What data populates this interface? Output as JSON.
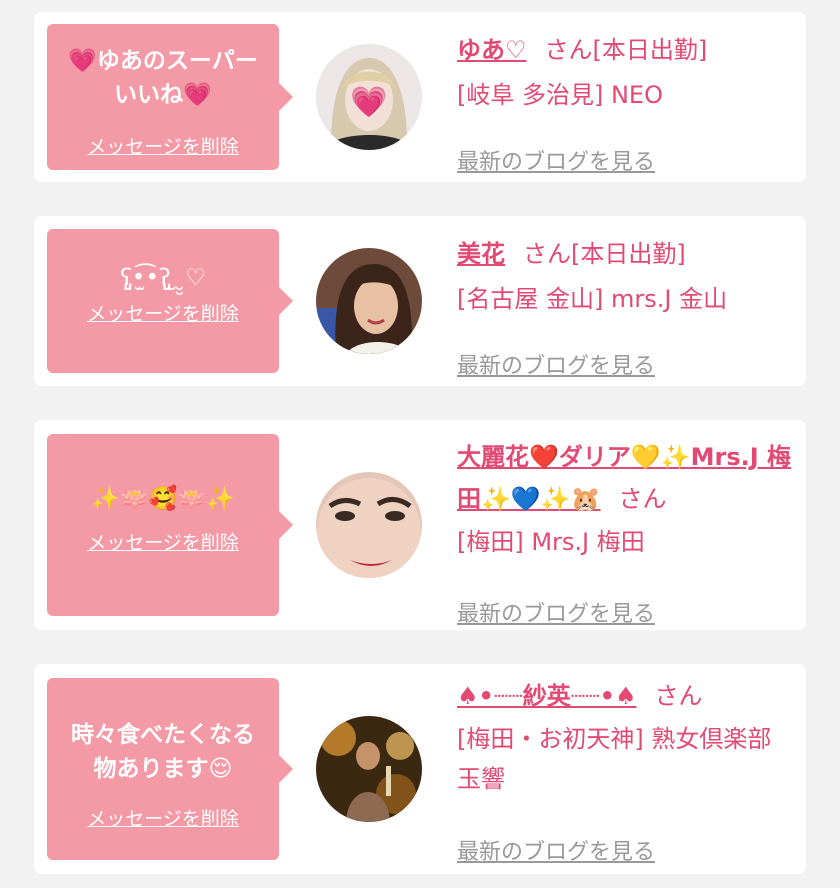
{
  "items": [
    {
      "bubble_message": "💗ゆあのスーパー\nいいね💗",
      "delete_label": "メッセージを削除",
      "name": "ゆあ♡",
      "san": "さん",
      "status": "[本日出勤]",
      "shop": "[岐阜 多治見] NEO",
      "blog_label": "最新のブログを見る"
    },
    {
      "bubble_message": "ʕ̡̢̡̡•̫͡•ʔ̢̡̢ ̮ ̮̮♡",
      "delete_label": "メッセージを削除",
      "name": "美花",
      "san": "さん",
      "status": "[本日出勤]",
      "shop": "[名古屋 金山] mrs.J 金山",
      "blog_label": "最新のブログを見る"
    },
    {
      "bubble_message": "✨🪷🥰🪷✨",
      "delete_label": "メッセージを削除",
      "name": "大麗花❤️ダリア💛✨Mrs.J 梅田✨💙✨🐹",
      "san": "さん",
      "status": "",
      "shop": "[梅田] Mrs.J 梅田",
      "blog_label": "最新のブログを見る"
    },
    {
      "bubble_message": "時々食べたくなる\n物あります😌",
      "delete_label": "メッセージを削除",
      "name": "♠•┈┈紗英┈┈•♠",
      "san": "さん",
      "status": "",
      "shop": "[梅田・お初天神] 熟女倶楽部 玉響",
      "blog_label": "最新のブログを見る"
    }
  ],
  "colors": {
    "background": "#f2f2f2",
    "card": "#ffffff",
    "bubble": "#f49aa6",
    "accent": "#e24a74",
    "link_gray": "#999999"
  }
}
